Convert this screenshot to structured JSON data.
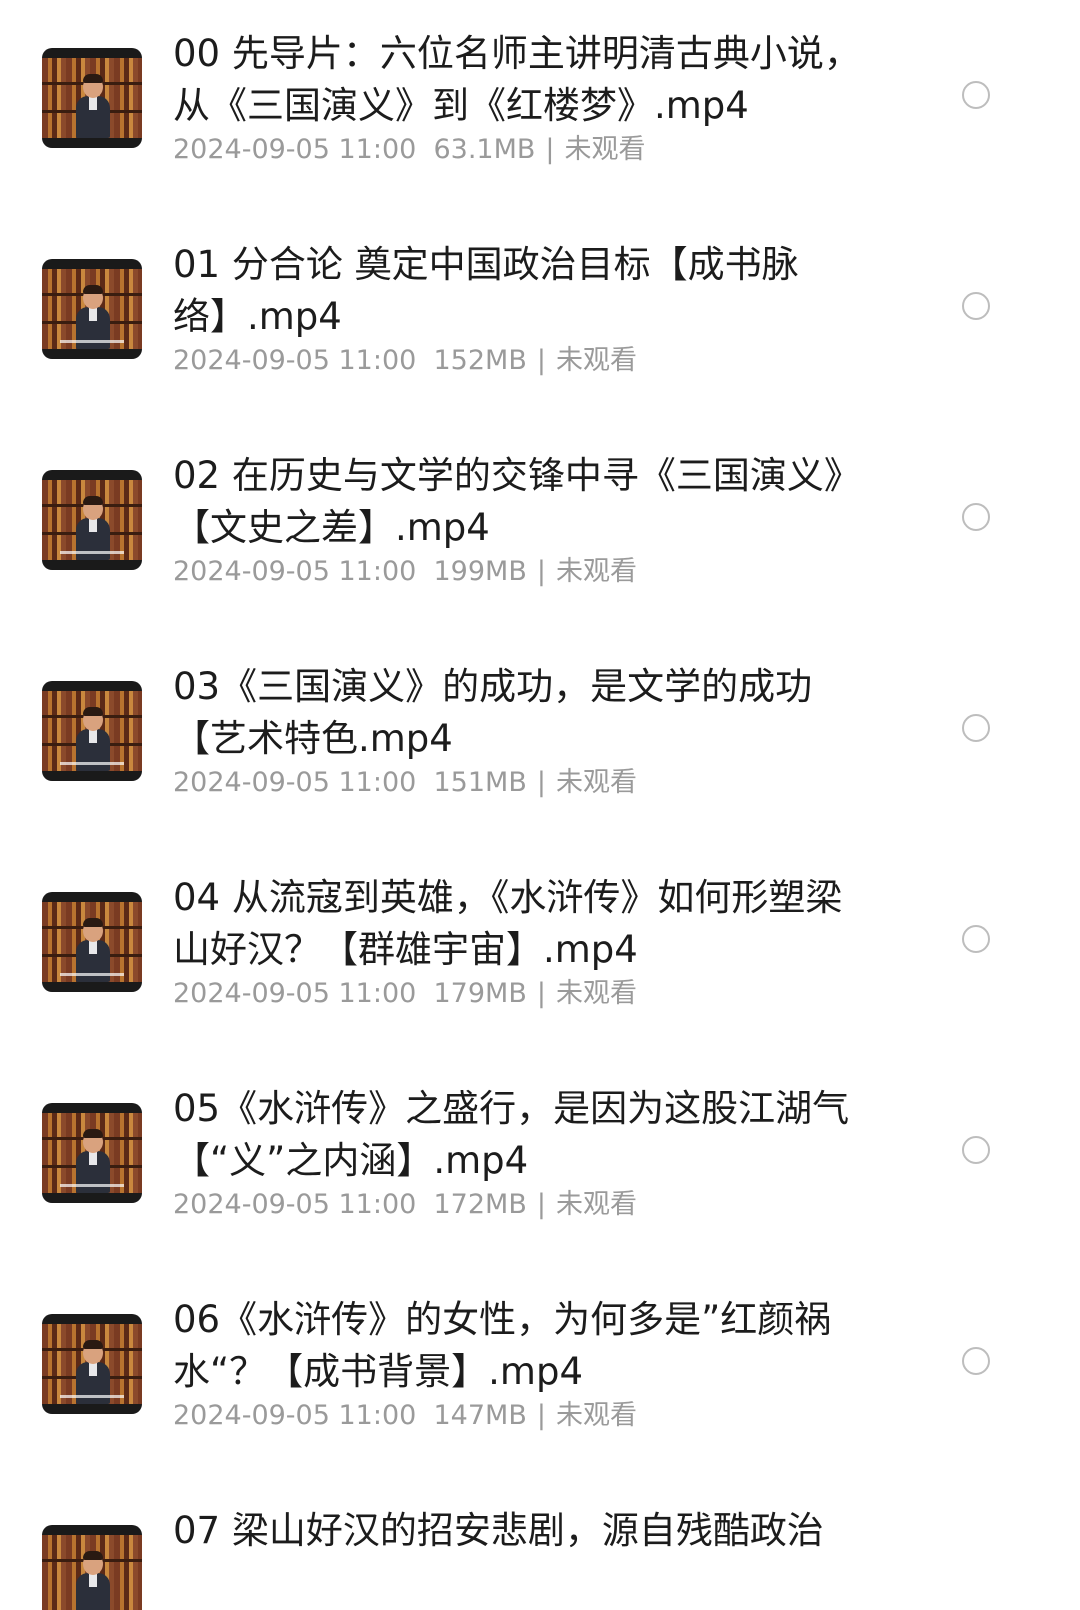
{
  "files": [
    {
      "title": "00 先导片：六位名师主讲明清古典小说，从《三国演义》到《红楼梦》.mp4",
      "date": "2024-09-05 11:00",
      "size": "63.1MB",
      "status": "未观看"
    },
    {
      "title": "01 分合论 奠定中国政治目标【成书脉络】.mp4",
      "date": "2024-09-05 11:00",
      "size": "152MB",
      "status": "未观看"
    },
    {
      "title": "02 在历史与文学的交锋中寻《三国演义》【文史之差】.mp4",
      "date": "2024-09-05 11:00",
      "size": "199MB",
      "status": "未观看"
    },
    {
      "title": "03《三国演义》的成功，是文学的成功【艺术特色.mp4",
      "date": "2024-09-05 11:00",
      "size": "151MB",
      "status": "未观看"
    },
    {
      "title": "04 从流寇到英雄，《水浒传》如何形塑梁山好汉？【群雄宇宙】.mp4",
      "date": "2024-09-05 11:00",
      "size": "179MB",
      "status": "未观看"
    },
    {
      "title": "05《水浒传》之盛行，是因为这股江湖气【“义”之内涵】.mp4",
      "date": "2024-09-05 11:00",
      "size": "172MB",
      "status": "未观看"
    },
    {
      "title": "06《水浒传》的女性，为何多是”红颜祸水“？【成书背景】.mp4",
      "date": "2024-09-05 11:00",
      "size": "147MB",
      "status": "未观看"
    },
    {
      "title": "07 梁山好汉的招安悲剧，源自残酷政治"
    }
  ],
  "meta_separator": "|"
}
